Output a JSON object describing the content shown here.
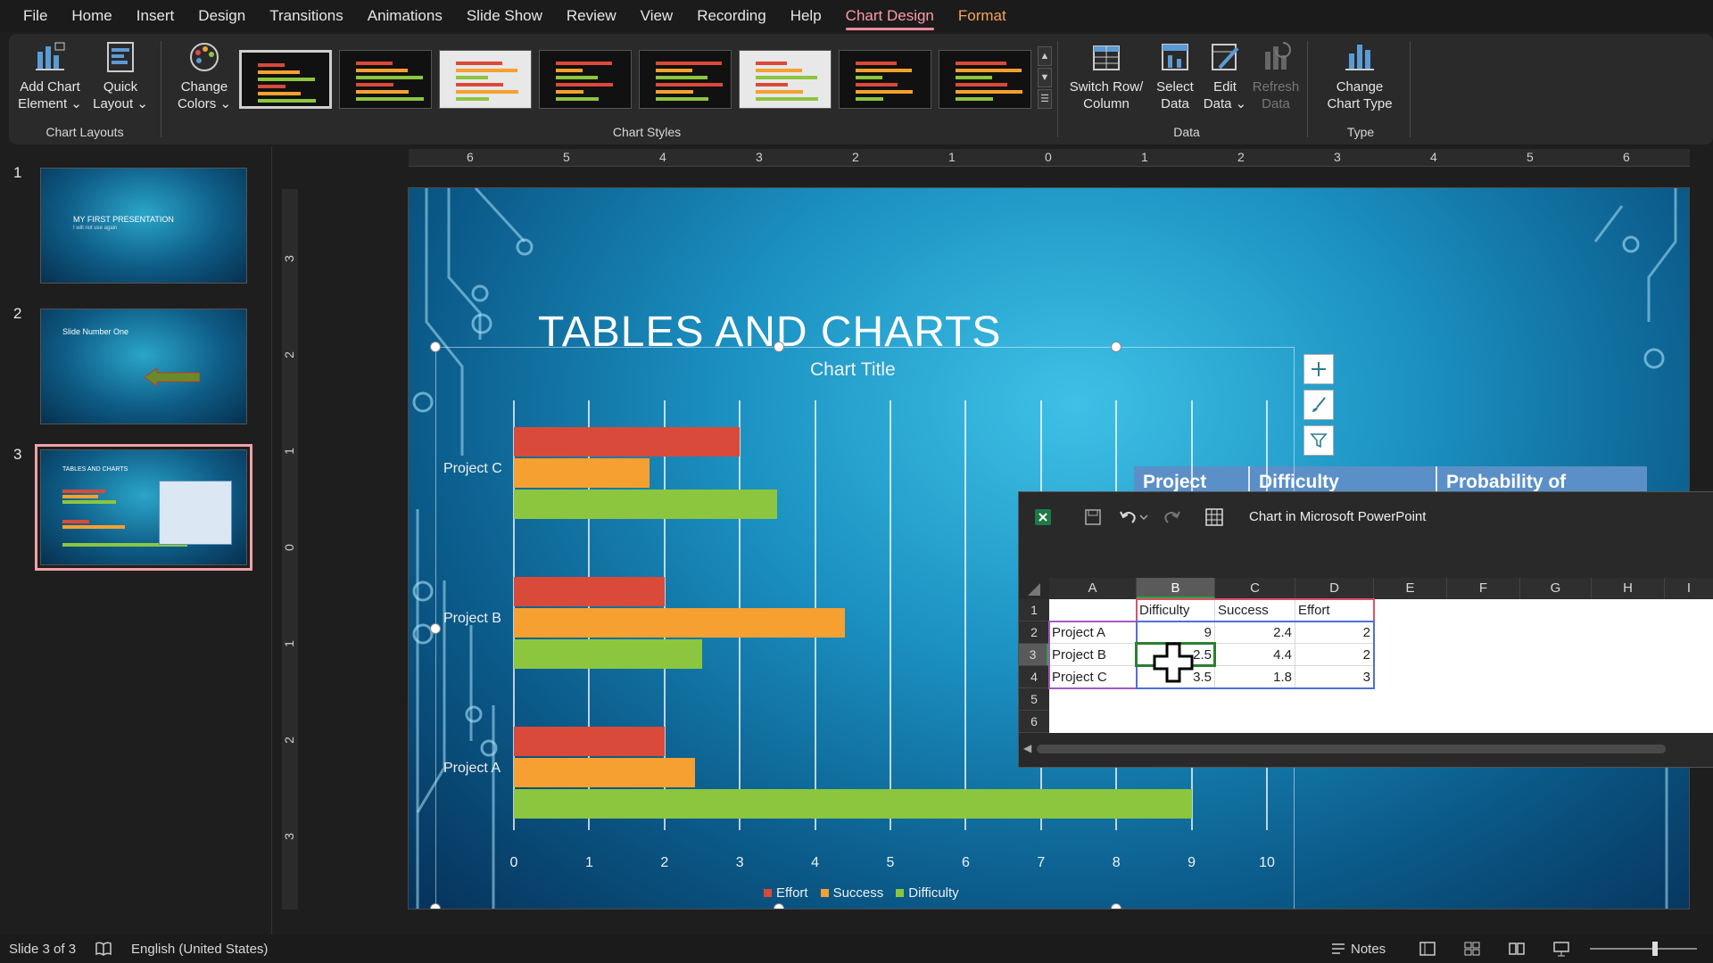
{
  "menu": {
    "tabs": [
      "File",
      "Home",
      "Insert",
      "Design",
      "Transitions",
      "Animations",
      "Slide Show",
      "Review",
      "View",
      "Recording",
      "Help",
      "Chart Design",
      "Format"
    ],
    "active_tab": "Chart Design"
  },
  "ribbon": {
    "chart_layouts": {
      "add_chart_element": [
        "Add Chart",
        "Element ⌄"
      ],
      "quick_layout": [
        "Quick",
        "Layout ⌄"
      ],
      "group_label": "Chart Layouts"
    },
    "change_colors": [
      "Change",
      "Colors ⌄"
    ],
    "chart_styles": {
      "group_label": "Chart Styles"
    },
    "data": {
      "switch_row_column": [
        "Switch Row/",
        "Column"
      ],
      "select_data": [
        "Select",
        "Data"
      ],
      "edit_data": [
        "Edit",
        "Data ⌄"
      ],
      "refresh_data": [
        "Refresh",
        "Data"
      ],
      "group_label": "Data"
    },
    "type": {
      "change_chart_type": [
        "Change",
        "Chart Type"
      ],
      "group_label": "Type"
    }
  },
  "slides": [
    {
      "number": "1",
      "title": "MY FIRST PRESENTATION",
      "subtitle": "I will not use again"
    },
    {
      "number": "2",
      "title": "Slide Number One"
    },
    {
      "number": "3",
      "title": "TABLES AND CHARTS"
    }
  ],
  "ruler": {
    "horizontal": [
      "6",
      "5",
      "4",
      "3",
      "2",
      "1",
      "0",
      "1",
      "2",
      "3",
      "4",
      "5",
      "6"
    ],
    "vertical": [
      "3",
      "2",
      "1",
      "0",
      "1",
      "2",
      "3"
    ]
  },
  "slide": {
    "title": "TABLES AND CHARTS",
    "table_header": [
      "Project",
      "Difficulty",
      "Probability of"
    ]
  },
  "chart_data": {
    "type": "bar",
    "orientation": "horizontal",
    "title": "Chart Title",
    "categories": [
      "Project A",
      "Project B",
      "Project C"
    ],
    "series": [
      {
        "name": "Effort",
        "color": "#d94a3a",
        "values": [
          2,
          2,
          3
        ]
      },
      {
        "name": "Success",
        "color": "#f5a031",
        "values": [
          2.4,
          4.4,
          1.8
        ]
      },
      {
        "name": "Difficulty",
        "color": "#8cc63f",
        "values": [
          9,
          2.5,
          3.5
        ]
      }
    ],
    "xlim": [
      0,
      10
    ],
    "xticks": [
      "0",
      "1",
      "2",
      "3",
      "4",
      "5",
      "6",
      "7",
      "8",
      "9",
      "10"
    ],
    "grid": true,
    "legend_position": "bottom"
  },
  "excel": {
    "title": "Chart in Microsoft PowerPoint",
    "columns": [
      "A",
      "B",
      "C",
      "D",
      "E",
      "F",
      "G",
      "H",
      "I"
    ],
    "rows": [
      "1",
      "2",
      "3",
      "4",
      "5",
      "6"
    ],
    "cells": [
      [
        "",
        "Difficulty",
        "Success",
        "Effort"
      ],
      [
        "Project A",
        "9",
        "2.4",
        "2"
      ],
      [
        "Project B",
        "2.5",
        "4.4",
        "2"
      ],
      [
        "Project C",
        "3.5",
        "1.8",
        "3"
      ]
    ],
    "selected_cell": "B3"
  },
  "status": {
    "slide_info": "Slide 3 of 3",
    "language": "English (United States)",
    "notes": "Notes"
  },
  "colors": {
    "accent": "#ff8a9a",
    "effort": "#d94a3a",
    "success": "#f5a031",
    "difficulty": "#8cc63f"
  }
}
